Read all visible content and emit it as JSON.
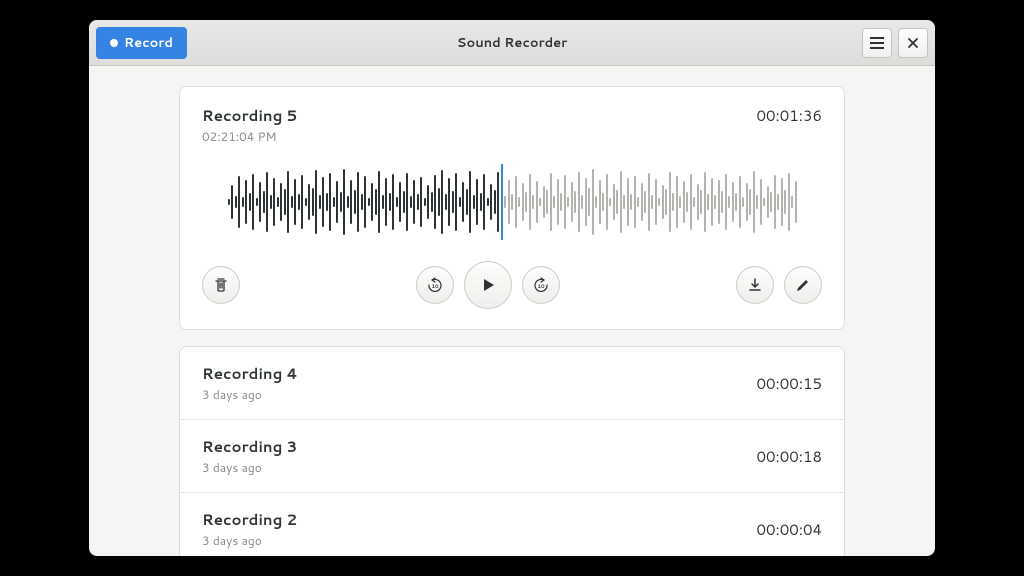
{
  "header": {
    "title": "Sound Recorder",
    "record_label": "Record"
  },
  "selected": {
    "name": "Recording 5",
    "timestamp": "02:21:04 PM",
    "duration": "00:01:36",
    "playhead_ratio": 0.48,
    "waveform": [
      6,
      34,
      12,
      52,
      10,
      44,
      18,
      56,
      8,
      40,
      22,
      60,
      14,
      48,
      10,
      38,
      26,
      62,
      12,
      46,
      16,
      54,
      8,
      36,
      28,
      64,
      14,
      50,
      18,
      58,
      10,
      42,
      20,
      66,
      12,
      44,
      24,
      60,
      16,
      52,
      8,
      38,
      26,
      62,
      14,
      48,
      18,
      56,
      10,
      40,
      22,
      58,
      12,
      44,
      16,
      50,
      8,
      34,
      20,
      54,
      28,
      64,
      16,
      48,
      22,
      58,
      10,
      40,
      26,
      62,
      14,
      46,
      18,
      56,
      8,
      36,
      24,
      60,
      12,
      44,
      16,
      52,
      10,
      38,
      20,
      56,
      14,
      42,
      8,
      32,
      24,
      58,
      12,
      46,
      18,
      54,
      10,
      40,
      22,
      60,
      14,
      48,
      28,
      66,
      12,
      44,
      18,
      56,
      8,
      36,
      24,
      62,
      14,
      48,
      16,
      52,
      10,
      38,
      22,
      58,
      14,
      46,
      8,
      34,
      26,
      60,
      18,
      52,
      12,
      42,
      20,
      56,
      10,
      36,
      24,
      60,
      16,
      48,
      14,
      44,
      22,
      56,
      12,
      40,
      18,
      52,
      10,
      38,
      26,
      62,
      14,
      46,
      8,
      32,
      20,
      54,
      16,
      48,
      24,
      58,
      12,
      42
    ]
  },
  "recordings": [
    {
      "name": "Recording 4",
      "meta": "3 days ago",
      "duration": "00:00:15"
    },
    {
      "name": "Recording 3",
      "meta": "3 days ago",
      "duration": "00:00:18"
    },
    {
      "name": "Recording 2",
      "meta": "3 days ago",
      "duration": "00:00:04"
    }
  ]
}
